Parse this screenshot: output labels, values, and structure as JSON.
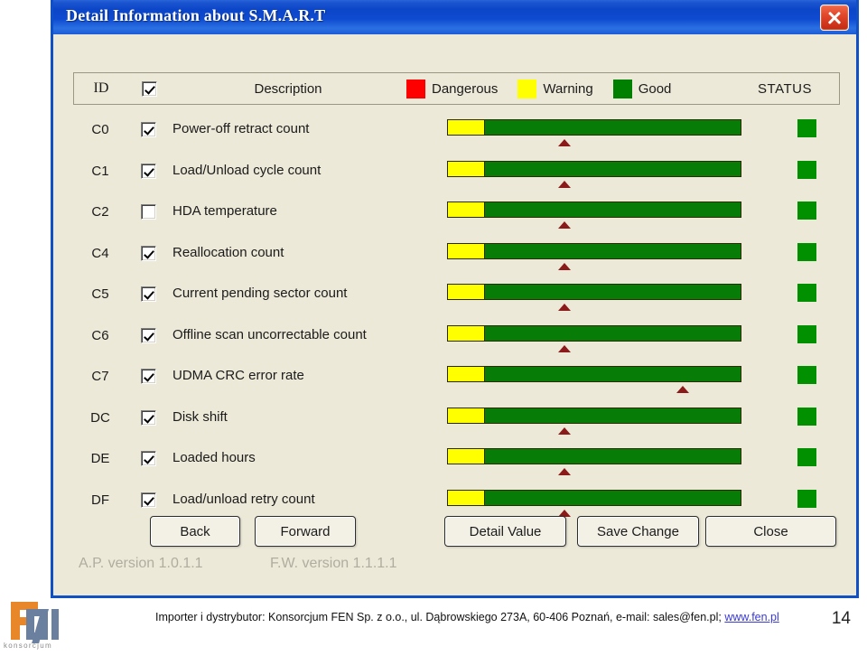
{
  "window": {
    "title": "Detail Information about S.M.A.R.T",
    "close_icon": "close-x-icon"
  },
  "header": {
    "id_label": "ID",
    "select_all_checked": true,
    "description_label": "Description",
    "legend": [
      {
        "label": "Dangerous",
        "color": "#fe0000"
      },
      {
        "label": "Warning",
        "color": "#ffff00"
      },
      {
        "label": "Good",
        "color": "#008000"
      }
    ],
    "status_label": "STATUS"
  },
  "colors": {
    "warning": "#ffff00",
    "good": "#077c07",
    "dangerous": "#fe0000",
    "marker": "#8b1a1a",
    "dialog_bg": "#ece9d8",
    "titlebar": "#0c46c8"
  },
  "rows": [
    {
      "id": "C0",
      "checked": true,
      "description": "Power-off retract count",
      "warning_pct": 12.5,
      "marker_pct": 40,
      "status": "good"
    },
    {
      "id": "C1",
      "checked": true,
      "description": "Load/Unload cycle count",
      "warning_pct": 12.5,
      "marker_pct": 40,
      "status": "good"
    },
    {
      "id": "C2",
      "checked": false,
      "description": "HDA temperature",
      "warning_pct": 12.5,
      "marker_pct": 40,
      "status": "good"
    },
    {
      "id": "C4",
      "checked": true,
      "description": "Reallocation count",
      "warning_pct": 12.5,
      "marker_pct": 40,
      "status": "good"
    },
    {
      "id": "C5",
      "checked": true,
      "description": "Current pending sector count",
      "warning_pct": 12.5,
      "marker_pct": 40,
      "status": "good"
    },
    {
      "id": "C6",
      "checked": true,
      "description": "Offline scan uncorrectable count",
      "warning_pct": 12.5,
      "marker_pct": 40,
      "status": "good"
    },
    {
      "id": "C7",
      "checked": true,
      "description": "UDMA CRC error rate",
      "warning_pct": 12.5,
      "marker_pct": 80,
      "status": "good"
    },
    {
      "id": "DC",
      "checked": true,
      "description": "Disk shift",
      "warning_pct": 12.5,
      "marker_pct": 40,
      "status": "good"
    },
    {
      "id": "DE",
      "checked": true,
      "description": "Loaded hours",
      "warning_pct": 12.5,
      "marker_pct": 40,
      "status": "good"
    },
    {
      "id": "DF",
      "checked": true,
      "description": "Load/unload retry count",
      "warning_pct": 12.5,
      "marker_pct": 40,
      "status": "good"
    }
  ],
  "buttons": {
    "back": "Back",
    "forward": "Forward",
    "detail_value": "Detail Value",
    "save_change": "Save Change",
    "close": "Close"
  },
  "versions": {
    "ap": "A.P. version 1.0.1.1",
    "fw": "F.W. version 1.1.1.1"
  },
  "footer": {
    "logo_caption": "konsorcjum",
    "text": "Importer i dystrybutor: Konsorcjum FEN Sp. z o.o., ul. Dąbrowskiego 273A, 60-406 Poznań, e-mail: sales@fen.pl; ",
    "link": "www.fen.pl",
    "page_number": "14"
  }
}
